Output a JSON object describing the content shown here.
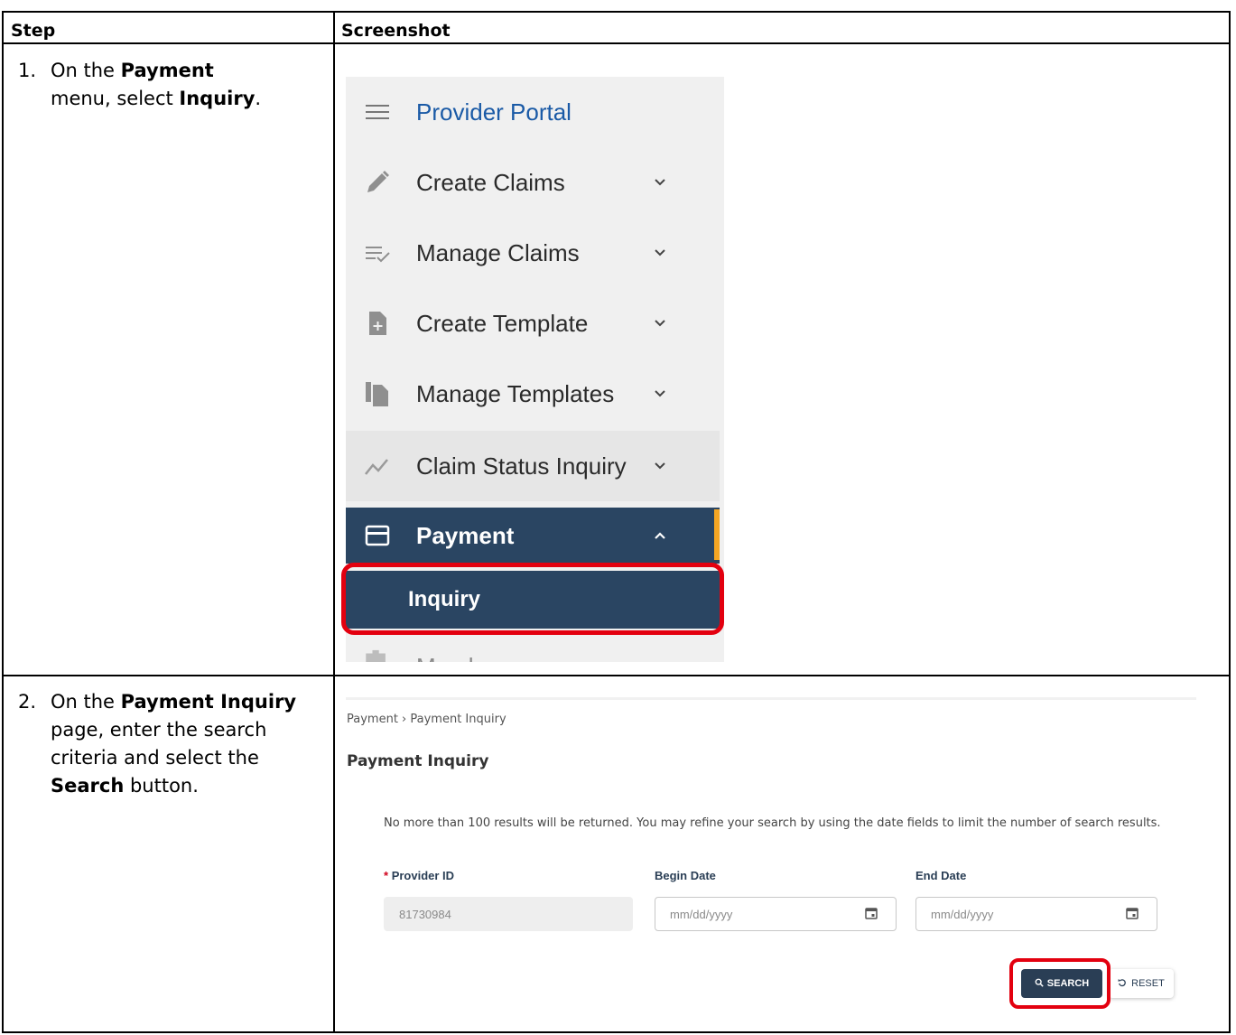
{
  "table": {
    "header_step": "Step",
    "header_screenshot": "Screenshot"
  },
  "steps": [
    {
      "number": "1.",
      "parts": [
        "On the ",
        "Payment",
        " menu, select ",
        "Inquiry",
        "."
      ]
    },
    {
      "number": "2.",
      "parts": [
        "On the ",
        "Payment Inquiry",
        " page, enter the search criteria and select the ",
        "Search",
        " button."
      ]
    }
  ],
  "menu": {
    "portal_title": "Provider Portal",
    "items": [
      {
        "label": "Create Claims",
        "icon": "pencil-icon"
      },
      {
        "label": "Manage Claims",
        "icon": "list-check-icon"
      },
      {
        "label": "Create Template",
        "icon": "file-add-icon"
      },
      {
        "label": "Manage Templates",
        "icon": "files-icon"
      },
      {
        "label": "Claim Status Inquiry",
        "icon": "trend-line-icon"
      },
      {
        "label": "Payment",
        "icon": "credit-card-icon"
      }
    ],
    "sub_item": "Inquiry",
    "partial_item": "Member",
    "colors": {
      "nav_dark": "#2a4562",
      "accent": "#f5a623",
      "highlight": "#e3000f",
      "link": "#1a5aa6"
    }
  },
  "inquiry": {
    "breadcrumb": "Payment › Payment Inquiry",
    "title": "Payment Inquiry",
    "notice": "No more than 100 results will be returned. You may refine your search by using the date fields to limit the number of search results.",
    "provider_label": "Provider ID",
    "provider_required_mark": "*",
    "provider_value": "81730984",
    "begin_label": "Begin Date",
    "begin_placeholder": "mm/dd/yyyy",
    "end_label": "End Date",
    "end_placeholder": "mm/dd/yyyy",
    "search_label": "SEARCH",
    "reset_label": "RESET"
  }
}
